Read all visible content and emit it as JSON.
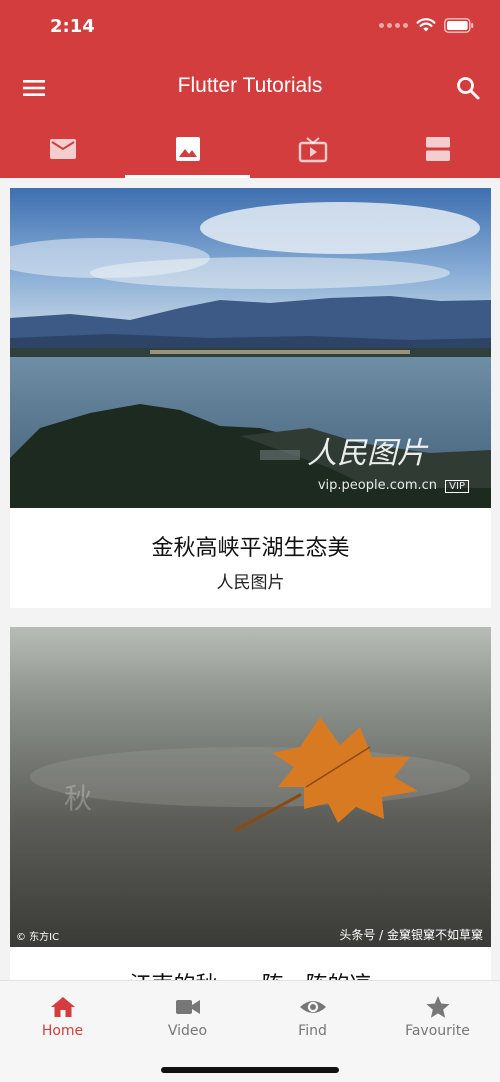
{
  "status_bar": {
    "time": "2:14"
  },
  "app_bar": {
    "title": "Flutter Tutorials",
    "menu_icon": "menu-icon",
    "search_icon": "search-icon"
  },
  "tabs": [
    {
      "icon": "mail-icon",
      "active": false
    },
    {
      "icon": "image-icon",
      "active": true
    },
    {
      "icon": "tv-icon",
      "active": false
    },
    {
      "icon": "view-agenda-icon",
      "active": false
    }
  ],
  "cards": [
    {
      "title": "金秋高峡平湖生态美",
      "source": "人民图片",
      "watermark": "人民图片",
      "watermark_url": "vip.people.com.cn",
      "watermark_badge": "VIP"
    },
    {
      "title": "江南的秋，一阵一阵的凉",
      "source": "",
      "caption_left": "© 东方IC",
      "caption_right": "头条号 / 金窠银窠不如草窠",
      "image_mark": "秋"
    }
  ],
  "bottom_nav": [
    {
      "label": "Home",
      "icon": "home-icon",
      "active": true
    },
    {
      "label": "Video",
      "icon": "video-icon",
      "active": false
    },
    {
      "label": "Find",
      "icon": "eye-icon",
      "active": false
    },
    {
      "label": "Favourite",
      "icon": "star-icon",
      "active": false
    }
  ],
  "colors": {
    "primary": "#d43d3d",
    "inactive": "#777777"
  }
}
